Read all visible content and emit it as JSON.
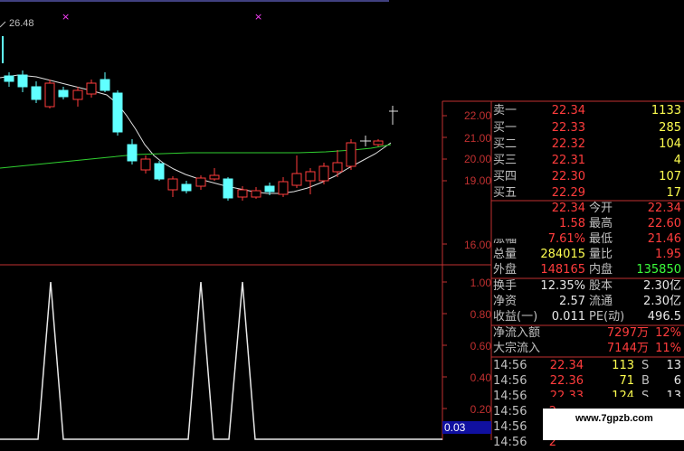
{
  "chart": {
    "top_label": "26.48",
    "price_axis": [
      "22.00",
      "21.00",
      "20.00",
      "19.00",
      "16.00"
    ],
    "indicator_axis": [
      "1.00",
      "0.80",
      "0.60",
      "0.40",
      "0.20"
    ],
    "indicator_value": "0.03",
    "markers": [
      "×",
      "×"
    ]
  },
  "order_book": [
    {
      "label": "卖一",
      "price": "22.34",
      "volume": "1133"
    },
    {
      "label": "买一",
      "price": "22.33",
      "volume": "285"
    },
    {
      "label": "买二",
      "price": "22.32",
      "volume": "104"
    },
    {
      "label": "买三",
      "price": "22.31",
      "volume": "4"
    },
    {
      "label": "买四",
      "price": "22.30",
      "volume": "107"
    },
    {
      "label": "买五",
      "price": "22.29",
      "volume": "17"
    }
  ],
  "stats": [
    {
      "label1": "",
      "value1": "22.34",
      "label2": "今开",
      "value2": "22.34"
    },
    {
      "label1": "",
      "value1": "1.58",
      "label2": "最高",
      "value2": "22.60"
    },
    {
      "label1": "涨幅",
      "value1": "7.61%",
      "label2": "最低",
      "value2": "21.46"
    },
    {
      "label1": "总量",
      "value1": "284015",
      "label2": "量比",
      "value2": "1.95"
    },
    {
      "label1": "外盘",
      "value1": "148165",
      "label2": "内盘",
      "value2": "135850"
    },
    {
      "label1": "换手",
      "value1": "12.35%",
      "label2": "股本",
      "value2": "2.30亿"
    },
    {
      "label1": "净资",
      "value1": "2.57",
      "label2": "流通",
      "value2": "2.30亿"
    },
    {
      "label1": "收益(一)",
      "value1": "0.011",
      "label2": "PE(动)",
      "value2": "496.5"
    }
  ],
  "flow": [
    {
      "label": "净流入额",
      "value": "7297万",
      "pct": "12%"
    },
    {
      "label": "大宗流入",
      "value": "7144万",
      "pct": "11%"
    }
  ],
  "ticks": [
    {
      "time": "14:56",
      "price": "22.34",
      "vol": "113",
      "side": "S",
      "n": "13"
    },
    {
      "time": "14:56",
      "price": "22.36",
      "vol": "71",
      "side": "B",
      "n": "6"
    },
    {
      "time": "14:56",
      "price": "22.33",
      "vol": "124",
      "side": "S",
      "n": "13"
    },
    {
      "time": "14:56",
      "price": "2",
      "vol": "",
      "side": "",
      "n": ""
    },
    {
      "time": "14:56",
      "price": "2",
      "vol": "",
      "side": "",
      "n": ""
    },
    {
      "time": "14:56",
      "price": "2",
      "vol": "",
      "side": "",
      "n": ""
    }
  ],
  "watermark": "www.7gpzb.com"
}
